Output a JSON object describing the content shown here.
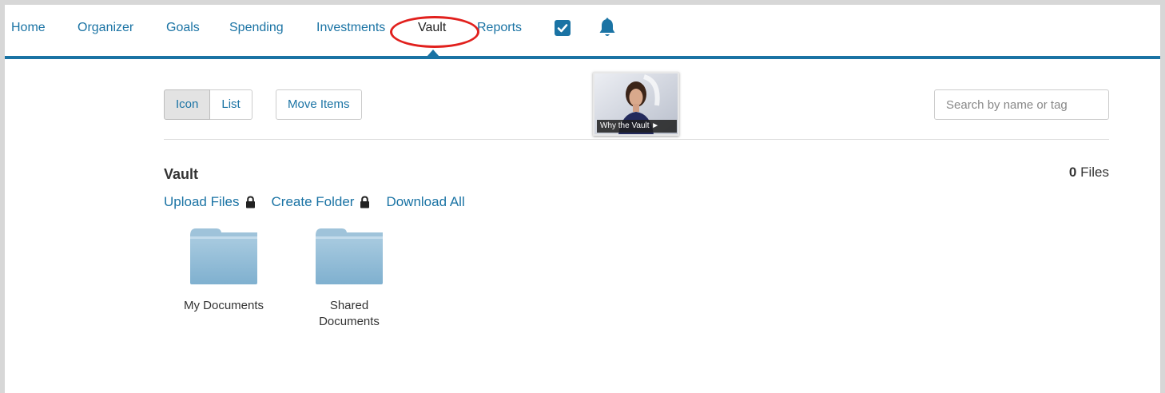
{
  "nav": {
    "items": [
      {
        "label": "Home"
      },
      {
        "label": "Organizer"
      },
      {
        "label": "Goals"
      },
      {
        "label": "Spending"
      },
      {
        "label": "Investments"
      },
      {
        "label": "Vault"
      },
      {
        "label": "Reports"
      }
    ],
    "active": "Vault",
    "colors": {
      "accent": "#1a73a4",
      "highlight": "#e1201d"
    }
  },
  "toolbar": {
    "view_icon_label": "Icon",
    "view_list_label": "List",
    "move_items_label": "Move Items",
    "video_caption": "Why the Vault ►",
    "search_placeholder": "Search by name or tag"
  },
  "vault": {
    "title": "Vault",
    "file_count": "0",
    "file_count_suffix": "Files",
    "actions": {
      "upload": "Upload Files",
      "create_folder": "Create Folder",
      "download_all": "Download All"
    },
    "folders": [
      {
        "name": "My Documents"
      },
      {
        "name": "Shared Documents"
      }
    ]
  }
}
